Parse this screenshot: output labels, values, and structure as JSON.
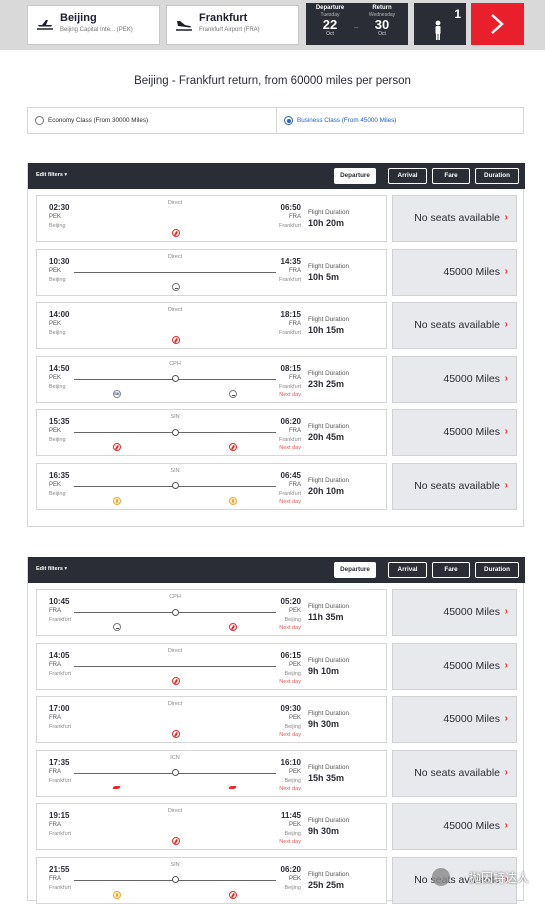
{
  "search": {
    "origin": {
      "city": "Beijing",
      "airport": "Beijing Capital Inte... (PEK)"
    },
    "destination": {
      "city": "Frankfurt",
      "airport": "Frankfurt Airport (FRA)"
    },
    "departure": {
      "label": "Departure",
      "weekday": "Tuesday",
      "day": "22",
      "month": "Oct"
    },
    "return": {
      "label": "Return",
      "weekday": "Wednesday",
      "day": "30",
      "month": "Oct"
    },
    "date_separator": "–",
    "passengers": "1"
  },
  "headline": "Beijing - Frankfurt return, from 60000 miles per person",
  "cabins": [
    {
      "label": "Economy Class (From 30000 Miles)",
      "selected": false
    },
    {
      "label": "Business Class (From 45000 Miles)",
      "selected": true
    }
  ],
  "filters": {
    "edit_label": "Edit filters ▾",
    "sort_buttons": [
      "Departure",
      "Arrival",
      "Fare",
      "Duration"
    ],
    "active_sort": "Departure"
  },
  "duration_label": "Flight Duration",
  "outbound": [
    {
      "dep_time": "02:30",
      "dep_code": "PEK",
      "dep_city": "Beijing",
      "arr_time": "06:50",
      "arr_code": "FRA",
      "arr_city": "Frankfurt",
      "stop": "Direct",
      "next_day": "",
      "duration": "10h 20m",
      "fare": "No seats available"
    },
    {
      "dep_time": "10:30",
      "dep_code": "PEK",
      "dep_city": "Beijing",
      "arr_time": "14:35",
      "arr_code": "FRA",
      "arr_city": "Frankfurt",
      "stop": "Direct",
      "next_day": "",
      "duration": "10h 5m",
      "fare": "45000 Miles"
    },
    {
      "dep_time": "14:00",
      "dep_code": "PEK",
      "dep_city": "Beijing",
      "arr_time": "18:15",
      "arr_code": "FRA",
      "arr_city": "Frankfurt",
      "stop": "Direct",
      "next_day": "",
      "duration": "10h 15m",
      "fare": "No seats available"
    },
    {
      "dep_time": "14:50",
      "dep_code": "PEK",
      "dep_city": "Beijing",
      "arr_time": "08:15",
      "arr_code": "FRA",
      "arr_city": "Frankfurt",
      "stop": "CPH",
      "next_day": "Next day",
      "duration": "23h 25m",
      "fare": "45000 Miles"
    },
    {
      "dep_time": "15:35",
      "dep_code": "PEK",
      "dep_city": "Beijing",
      "arr_time": "06:20",
      "arr_code": "FRA",
      "arr_city": "Frankfurt",
      "stop": "SIN",
      "next_day": "Next day",
      "duration": "20h 45m",
      "fare": "45000 Miles"
    },
    {
      "dep_time": "16:35",
      "dep_code": "PEK",
      "dep_city": "Beijing",
      "arr_time": "06:45",
      "arr_code": "FRA",
      "arr_city": "Frankfurt",
      "stop": "SIN",
      "next_day": "Next day",
      "duration": "20h 10m",
      "fare": "No seats available"
    }
  ],
  "inbound": [
    {
      "dep_time": "10:45",
      "dep_code": "FRA",
      "dep_city": "Frankfurt",
      "arr_time": "05:20",
      "arr_code": "PEK",
      "arr_city": "Beijing",
      "stop": "CPH",
      "next_day": "Next day",
      "duration": "11h 35m",
      "fare": "45000 Miles"
    },
    {
      "dep_time": "14:05",
      "dep_code": "FRA",
      "dep_city": "Frankfurt",
      "arr_time": "06:15",
      "arr_code": "PEK",
      "arr_city": "Beijing",
      "stop": "Direct",
      "next_day": "Next day",
      "duration": "9h 10m",
      "fare": "45000 Miles"
    },
    {
      "dep_time": "17:00",
      "dep_code": "FRA",
      "dep_city": "Frankfurt",
      "arr_time": "09:30",
      "arr_code": "PEK",
      "arr_city": "Beijing",
      "stop": "Direct",
      "next_day": "Next day",
      "duration": "9h 30m",
      "fare": "45000 Miles"
    },
    {
      "dep_time": "17:35",
      "dep_code": "FRA",
      "dep_city": "Frankfurt",
      "arr_time": "16:10",
      "arr_code": "PEK",
      "arr_city": "Beijing",
      "stop": "ICN",
      "next_day": "Next day",
      "duration": "15h 35m",
      "fare": "No seats available"
    },
    {
      "dep_time": "19:15",
      "dep_code": "FRA",
      "dep_city": "Frankfurt",
      "arr_time": "11:45",
      "arr_code": "PEK",
      "arr_city": "Beijing",
      "stop": "Direct",
      "next_day": "Next day",
      "duration": "9h 30m",
      "fare": "45000 Miles"
    },
    {
      "dep_time": "21:55",
      "dep_code": "FRA",
      "dep_city": "Frankfurt",
      "arr_time": "06:20",
      "arr_code": "PEK",
      "arr_city": "Beijing",
      "stop": "SIN",
      "next_day": "",
      "duration": "25h 25m",
      "fare": "No seats available"
    }
  ],
  "watermark": "抛因特达人",
  "colors": {
    "accent": "#ea1f2c",
    "header": "#2b2d36",
    "selected": "#2563c9",
    "fare_bg": "#e8e9ec"
  }
}
